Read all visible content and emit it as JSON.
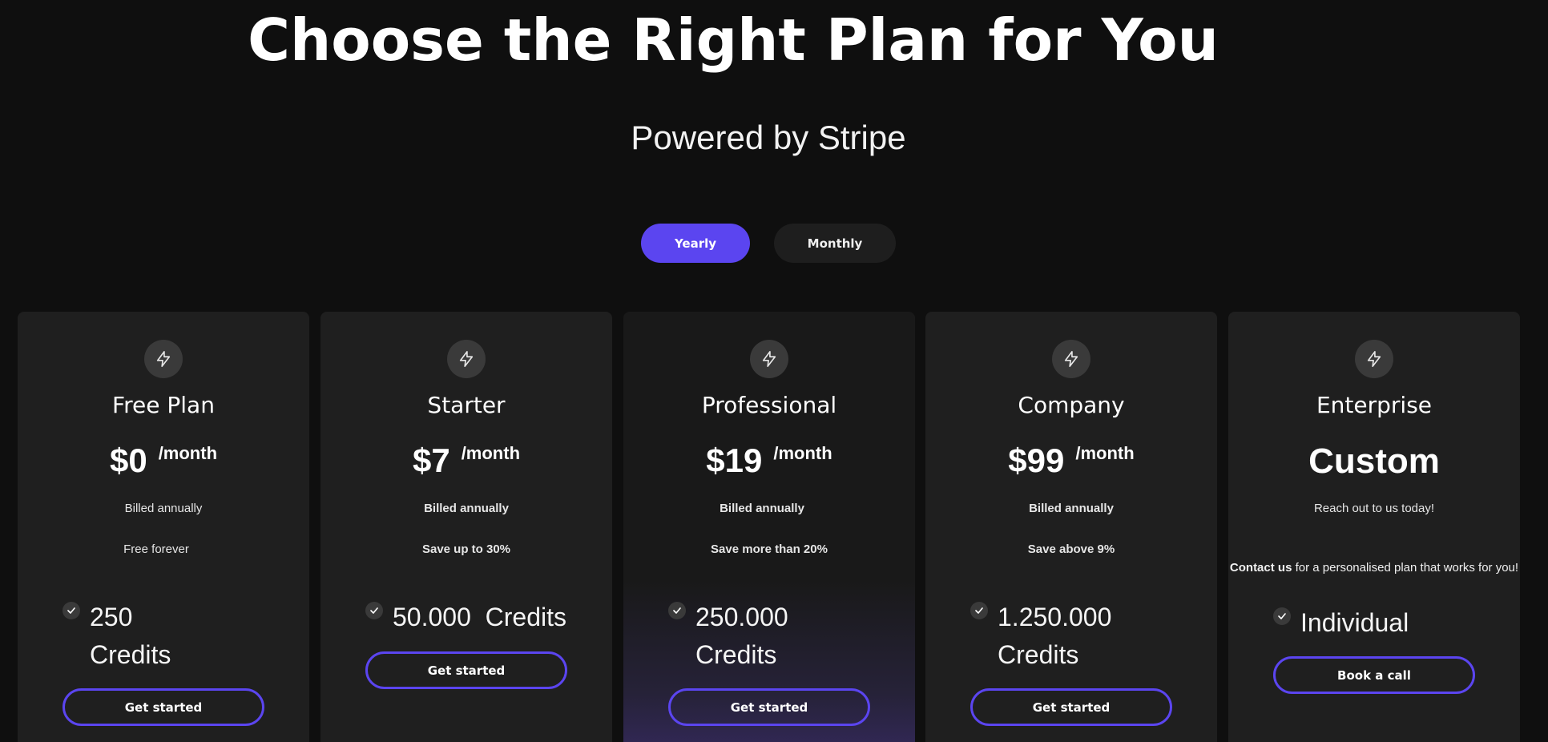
{
  "header": {
    "title": "Choose the Right Plan for You",
    "subtitle": "Powered by Stripe"
  },
  "billing_toggle": {
    "yearly_label": "Yearly",
    "monthly_label": "Monthly",
    "selected": "Yearly"
  },
  "colors": {
    "accent": "#5b45f0",
    "background": "#0f0f0f",
    "card": "#1f1f1f"
  },
  "plans": [
    {
      "icon": "lightning-icon",
      "name": "Free Plan",
      "price": "$0",
      "period": "/month",
      "billing": "Billed annually",
      "note": "Free forever",
      "feature": "250 Credits",
      "feature_line1": "250",
      "feature_line2": "Credits",
      "cta": "Get started"
    },
    {
      "icon": "lightning-icon",
      "name": "Starter",
      "price": "$7",
      "period": "/month",
      "billing": "Billed annually",
      "note": "Save up to 30%",
      "feature": "50.000  Credits",
      "cta": "Get started"
    },
    {
      "icon": "lightning-icon",
      "name": "Professional",
      "price": "$19",
      "period": "/month",
      "billing": "Billed annually",
      "note": "Save more than 20%",
      "feature": "250.000 Credits",
      "feature_line1": "250.000",
      "feature_line2": "Credits",
      "cta": "Get started"
    },
    {
      "icon": "lightning-icon",
      "name": "Company",
      "price": "$99",
      "period": "/month",
      "billing": "Billed annually",
      "note": "Save above 9%",
      "feature": "1.250.000 Credits",
      "feature_line1": "1.250.000",
      "feature_line2": "Credits",
      "cta": "Get started"
    },
    {
      "icon": "lightning-icon",
      "name": "Enterprise",
      "price": "Custom",
      "billing": "Reach out to us today!",
      "contact_bold": "Contact us",
      "contact_rest": " for a personalised plan that works for you!",
      "feature": "Individual",
      "cta": "Book a call"
    }
  ]
}
